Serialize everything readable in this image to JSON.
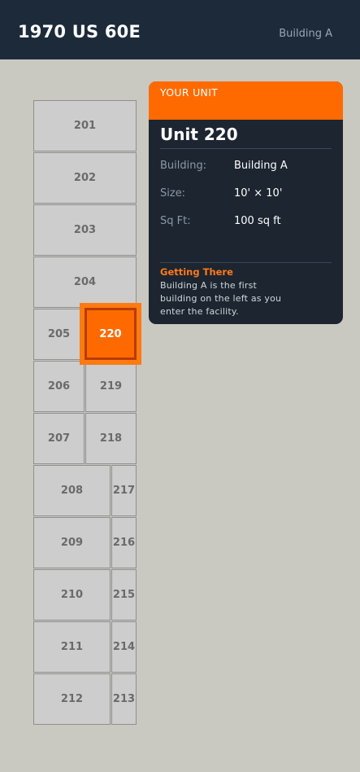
{
  "header": {
    "title": "1970 US 60E",
    "building_label": "Building A"
  },
  "units": {
    "u201": "201",
    "u202": "202",
    "u203": "203",
    "u204": "204",
    "u205": "205",
    "u220": "220",
    "u206": "206",
    "u219": "219",
    "u207": "207",
    "u218": "218",
    "u208": "208",
    "u217": "217",
    "u209": "209",
    "u216": "216",
    "u210": "210",
    "u215": "215",
    "u211": "211",
    "u214": "214",
    "u212": "212",
    "u213": "213",
    "selected": "220"
  },
  "card": {
    "kicker": "YOUR UNIT",
    "unit_name": "Unit 220",
    "building_key": "Building:",
    "building_value": "Building A",
    "size_key": "Size:",
    "size_value": "10' × 10'",
    "sqft_key": "Sq Ft:",
    "sqft_value": "100 sq ft",
    "getting_title": "Getting There",
    "getting_body": "Building A is the first building on the left as you enter the facility."
  },
  "colors": {
    "header_bg": "#1c2a3a",
    "page_bg": "#c9c9c1",
    "accent": "#ff6a00",
    "card_bg": "#1c2530",
    "unit_bg": "#cdcdcd"
  }
}
